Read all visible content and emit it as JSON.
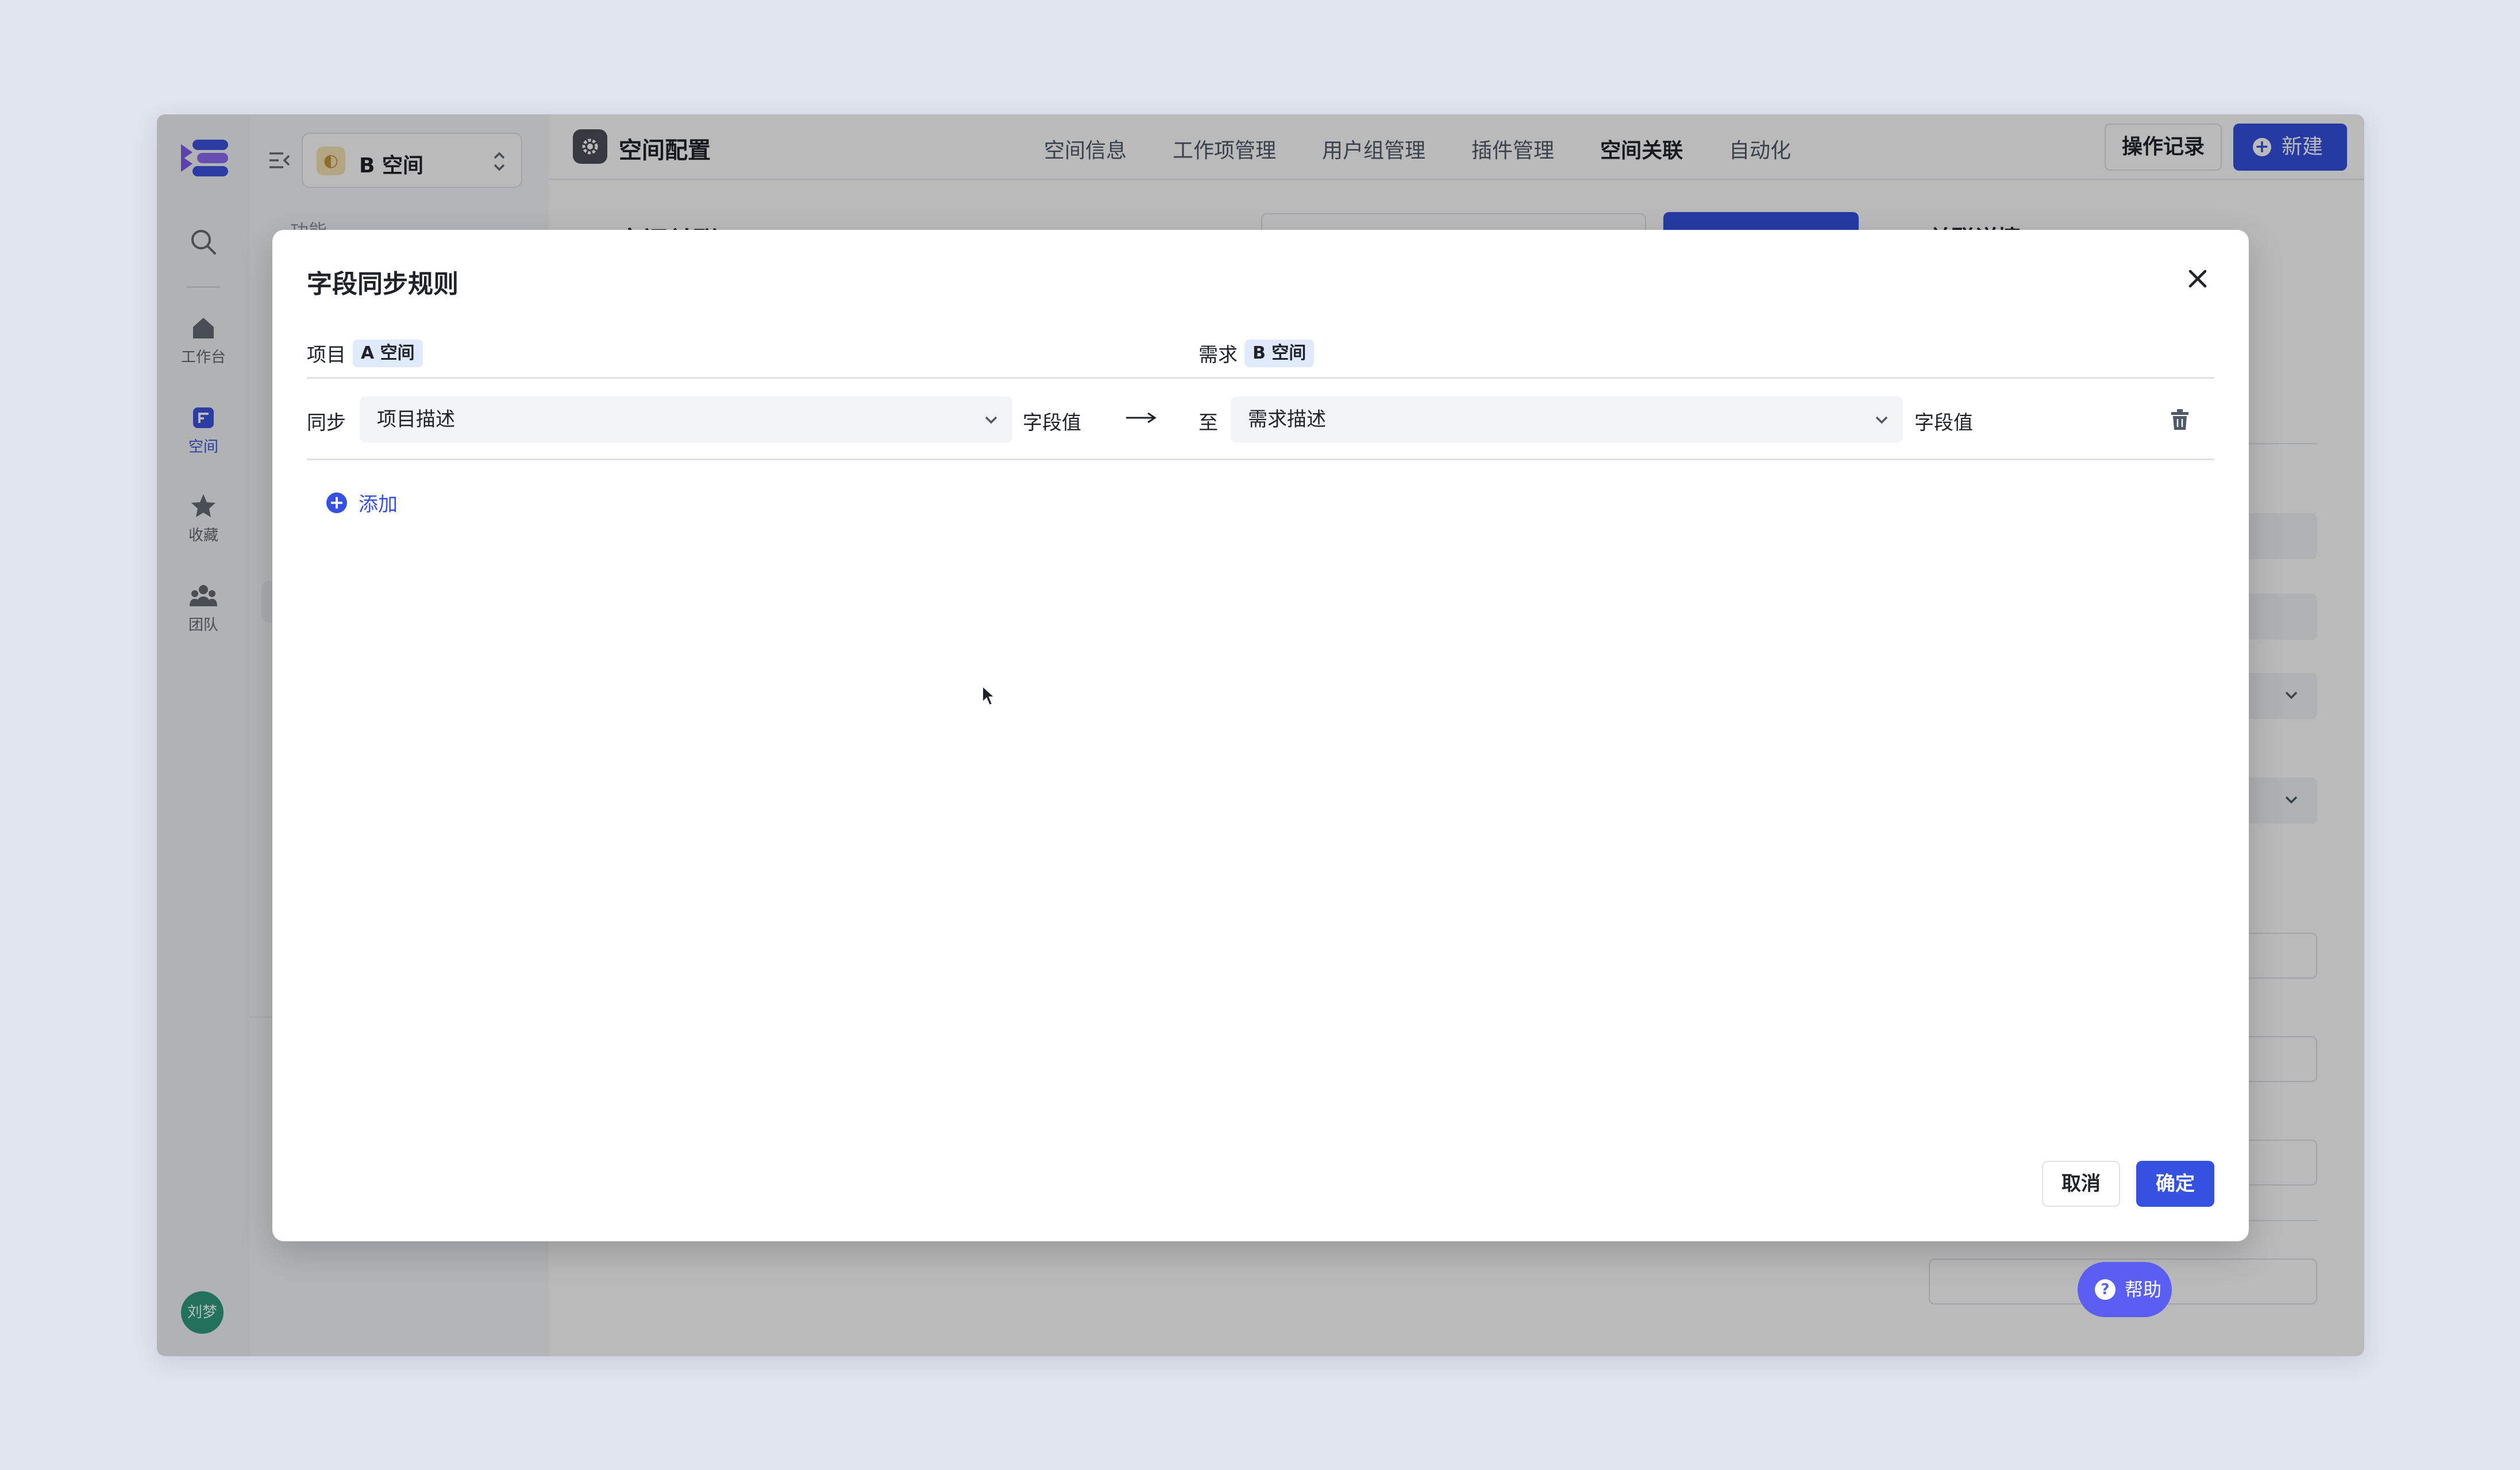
{
  "rail": {
    "items": [
      {
        "label": "工作台",
        "icon": "home-icon"
      },
      {
        "label": "空间",
        "icon": "space-icon"
      },
      {
        "label": "收藏",
        "icon": "star-icon"
      },
      {
        "label": "团队",
        "icon": "team-icon"
      }
    ],
    "avatar": "刘梦"
  },
  "sidebar": {
    "space_name": "B 空间",
    "section_label": "功能"
  },
  "topbar": {
    "title": "空间配置",
    "tabs": [
      "空间信息",
      "工作项管理",
      "用户组管理",
      "插件管理",
      "空间关联",
      "自动化"
    ],
    "active_tab": "空间关联",
    "record_button": "操作记录",
    "new_button": "新建"
  },
  "main": {
    "heading": "空间关联",
    "right_panel_heading": "关联详情",
    "delete_rule": "删除规则"
  },
  "help_button": "帮助",
  "modal": {
    "title": "字段同步规则",
    "left_header": {
      "label": "项目",
      "tag": "A 空间"
    },
    "right_header": {
      "label": "需求",
      "tag": "B 空间"
    },
    "rule": {
      "sync_label": "同步",
      "source_field": "项目描述",
      "source_value_label": "字段值",
      "to_label": "至",
      "target_field": "需求描述",
      "target_value_label": "字段值"
    },
    "add_label": "添加",
    "cancel": "取消",
    "confirm": "确定"
  },
  "colors": {
    "primary": "#3451e0",
    "help": "#5b5ef2",
    "danger": "#d6322b",
    "tag_bg": "#e1e9fd"
  }
}
